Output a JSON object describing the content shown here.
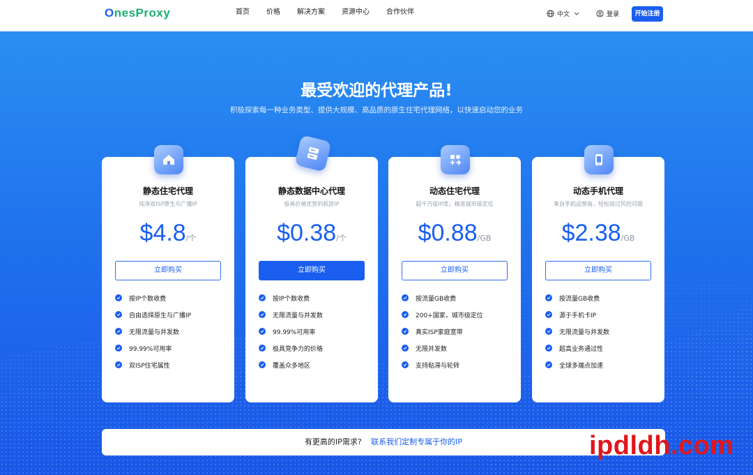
{
  "header": {
    "logo_first": "O",
    "logo_rest": "nesProxy",
    "nav": [
      "首页",
      "价格",
      "解决方案",
      "资源中心",
      "合作伙伴"
    ],
    "language": "中文",
    "login": "登录",
    "signup": "开始注册"
  },
  "hero": {
    "title": "最受欢迎的代理产品!",
    "subtitle": "积极探索每一种业务类型、提供大规模、高品质的原生住宅代理网络，以快速启动您的业务"
  },
  "cards": [
    {
      "icon": "home-icon",
      "name": "静态住宅代理",
      "desc": "纯净双ISP原生与广播IP",
      "price": "$4.8",
      "unit": "/个",
      "button": "立即购买",
      "features": [
        "按IP个数收费",
        "自由选择原生与广播IP",
        "无限流量与并发数",
        "99.99%可用率",
        "双ISP住宅属性"
      ]
    },
    {
      "icon": "server-icon",
      "name": "静态数据中心代理",
      "desc": "极具价格优势的机房IP",
      "price": "$0.38",
      "unit": "/个",
      "button": "立即购买",
      "features": [
        "按IP个数收费",
        "无限流量与并发数",
        "99.99%可用率",
        "极具竞争力的价格",
        "覆盖众多地区"
      ]
    },
    {
      "icon": "apps-icon",
      "name": "动态住宅代理",
      "desc": "超千万级IP库，精准城市级定位",
      "price": "$0.88",
      "unit": "/GB",
      "button": "立即购买",
      "features": [
        "按流量GB收费",
        "200+国家，城市级定位",
        "真实ISP家庭宽带",
        "无限并发数",
        "支持粘滞与轮转"
      ]
    },
    {
      "icon": "mobile-icon",
      "name": "动态手机代理",
      "desc": "来自手机运营商，轻松绕过风控问题",
      "price": "$2.38",
      "unit": "/GB",
      "button": "立即购买",
      "features": [
        "按流量GB收费",
        "源于手机卡IP",
        "无限流量与并发数",
        "超高业务通过性",
        "全球多端点加速"
      ]
    }
  ],
  "banner": {
    "question": "有更高的IP需求?",
    "link": "联系我们定制专属于你的IP"
  },
  "watermark": "ipdldh.com",
  "colors": {
    "primary": "#1a5ef0",
    "logo_green": "#18b06e",
    "watermark_red": "#e0161b"
  }
}
